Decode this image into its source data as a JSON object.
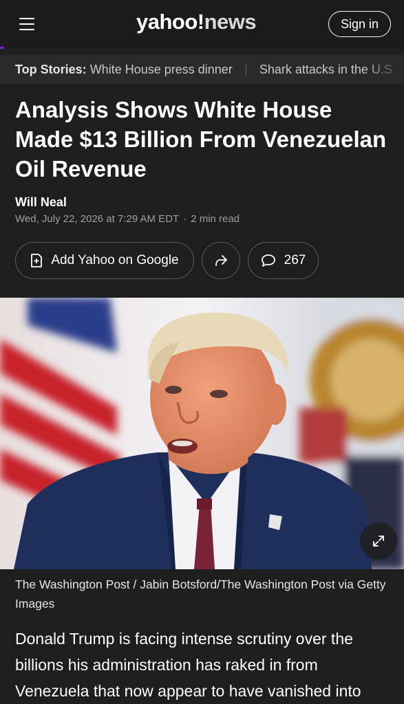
{
  "header": {
    "logo_main": "yahoo!",
    "logo_sub": "news",
    "signin_label": "Sign in"
  },
  "top_stories": {
    "label": "Top Stories:",
    "items": [
      "White House press dinner",
      "Shark attacks in the U.S"
    ]
  },
  "article": {
    "headline": "Analysis Shows White House Made $13 Billion From Venezuelan Oil Revenue",
    "author": "Will Neal",
    "date": "Wed, July 22, 2026 at 7:29 AM EDT",
    "read_time": "2 min read",
    "separator": "·",
    "add_google_label": "Add Yahoo on Google",
    "comment_count": "267",
    "caption": "The Washington Post / Jabin Botsford/The Washington Post via Getty Images",
    "body": "Donald Trump is facing intense scrutiny over the billions his administration has raked in from Venezuela that now appear to have vanished into"
  },
  "icons": {
    "menu": "hamburger-icon",
    "add": "add-doc-icon",
    "share": "share-icon",
    "comment": "comment-icon",
    "expand": "expand-icon"
  },
  "colors": {
    "background": "#1e1e1e",
    "accent": "#7e1fff"
  }
}
